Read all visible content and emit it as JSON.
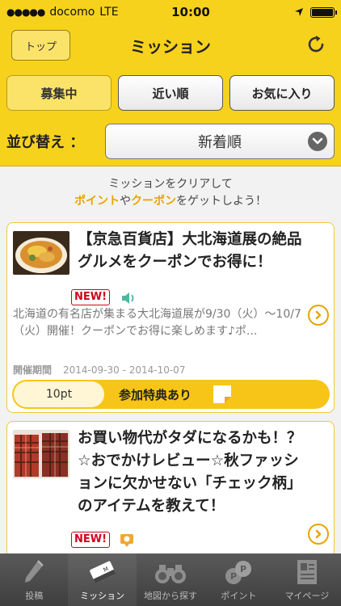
{
  "status_bar": {
    "carrier": "docomo",
    "network": "LTE",
    "time": "10:00"
  },
  "nav": {
    "title": "ミッション",
    "top_button": "トップ"
  },
  "tabs": [
    {
      "label": "募集中",
      "active": true
    },
    {
      "label": "近い順",
      "active": false
    },
    {
      "label": "お気に入り",
      "active": false
    }
  ],
  "sort": {
    "label": "並び替え ：",
    "selected": "新着順"
  },
  "intro": {
    "line1": "ミッションをクリアして",
    "point": "ポイント",
    "ya": "や",
    "coupon": "クーポン",
    "tail": "をゲットしよう！"
  },
  "missions": [
    {
      "title": "【京急百貨店】大北海道展の絶品グルメをクーポンでお得に！",
      "badge": "NEW!",
      "description": "北海道の有名店が集まる大北海道展が9/30（火）〜10/7（火）開催！クーポンでお得に楽しめます♪ポ...",
      "period_label": "開催期間",
      "period": "2014-09-30 - 2014-10-07",
      "points": "10pt",
      "reward": "参加特典あり"
    },
    {
      "title": "お買い物代がタダになるかも！？☆おでかけレビュー☆秋ファッションに欠かせない「チェック柄」のアイテムを教えて！",
      "badge": "NEW!"
    }
  ],
  "bottom_tabs": [
    {
      "label": "投稿",
      "icon": "pen-icon",
      "active": false
    },
    {
      "label": "ミッション",
      "icon": "mission-card-icon",
      "active": true
    },
    {
      "label": "地図から探す",
      "icon": "binoculars-icon",
      "active": false
    },
    {
      "label": "ポイント",
      "icon": "coins-icon",
      "active": false
    },
    {
      "label": "マイページ",
      "icon": "profile-card-icon",
      "active": false
    }
  ],
  "colors": {
    "brand_yellow": "#f7d21c",
    "accent_orange": "#e8a400",
    "new_red": "#d0021b"
  }
}
